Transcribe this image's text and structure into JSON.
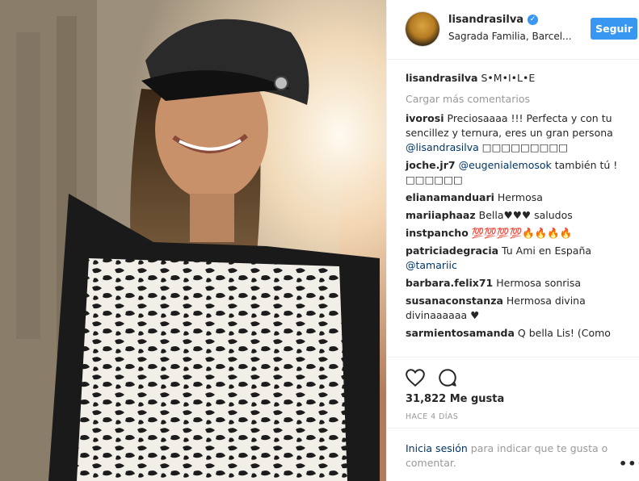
{
  "header": {
    "username": "lisandrasilva",
    "verified_glyph": "✓",
    "location": "Sagrada Familia, Barcel...",
    "follow_label": "Seguir"
  },
  "caption": {
    "username": "lisandrasilva",
    "text": "S•M•I•L•E"
  },
  "load_more_label": "Cargar más comentarios",
  "comments": [
    {
      "user": "ivorosi",
      "text": "Preciosaaaa !!! Perfecta y con tu sencillez y ternura, eres un gran persona",
      "mention": "@lisandrasilva",
      "tail": "□□□□□□□□□"
    },
    {
      "user": "joche.jr7",
      "mention": "@eugenialemosok",
      "text": "también tú ! □□□□□□"
    },
    {
      "user": "elianamanduari",
      "text": "Hermosa"
    },
    {
      "user": "mariiaphaaz",
      "text": "Bella♥♥♥ saludos"
    },
    {
      "user": "instpancho",
      "text": "💯💯💯💯🔥🔥🔥🔥"
    },
    {
      "user": "patriciadegracia",
      "text": "Tu Ami en España",
      "mention": "@tamariic"
    },
    {
      "user": "barbara.felix71",
      "text": "Hermosa sonrisa"
    },
    {
      "user": "susanaconstanza",
      "text": "Hermosa divina divinaaaaaa ♥"
    },
    {
      "user": "sarmientosamanda",
      "text": "Q bella Lis! (Como"
    }
  ],
  "likes_label": "31,822 Me gusta",
  "time_label": "HACE 4 DÍAS",
  "login": {
    "link": "Inicia sesión",
    "rest": " para indicar que te gusta o comentar."
  },
  "more_label": "•••",
  "icons": {
    "like": "heart-icon",
    "comment": "comment-icon",
    "verified": "verified-badge-icon",
    "more": "more-options-icon"
  },
  "colors": {
    "accent": "#3897f0",
    "link": "#003569",
    "muted": "#999999",
    "text": "#262626"
  }
}
